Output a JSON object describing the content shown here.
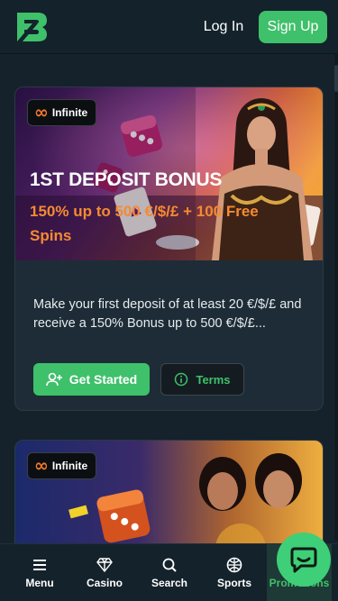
{
  "header": {
    "login_label": "Log In",
    "signup_label": "Sign Up",
    "accent": "#3fc06a"
  },
  "promos": [
    {
      "badge_label": "Infinite",
      "title": "1ST DEPOSIT BONUS",
      "subtitle": "150% up to 500 €/$/£ + 100 Free Spins",
      "description": "Make your first deposit of at least 20 €/$/£ and receive a 150% Bonus up to 500 €/$/£...",
      "cta_label": "Get Started",
      "terms_label": "Terms"
    },
    {
      "badge_label": "Infinite"
    }
  ],
  "bottom_nav": {
    "items": [
      {
        "label": "Menu",
        "icon": "menu-icon"
      },
      {
        "label": "Casino",
        "icon": "diamond-icon"
      },
      {
        "label": "Search",
        "icon": "search-icon"
      },
      {
        "label": "Sports",
        "icon": "ball-icon"
      },
      {
        "label": "Promotions",
        "icon": "gift-icon"
      }
    ],
    "active": "Promotions"
  },
  "colors": {
    "background": "#16222b",
    "card": "#1d2c36",
    "accent": "#3fc06a",
    "promo_orange": "#f58a32"
  }
}
